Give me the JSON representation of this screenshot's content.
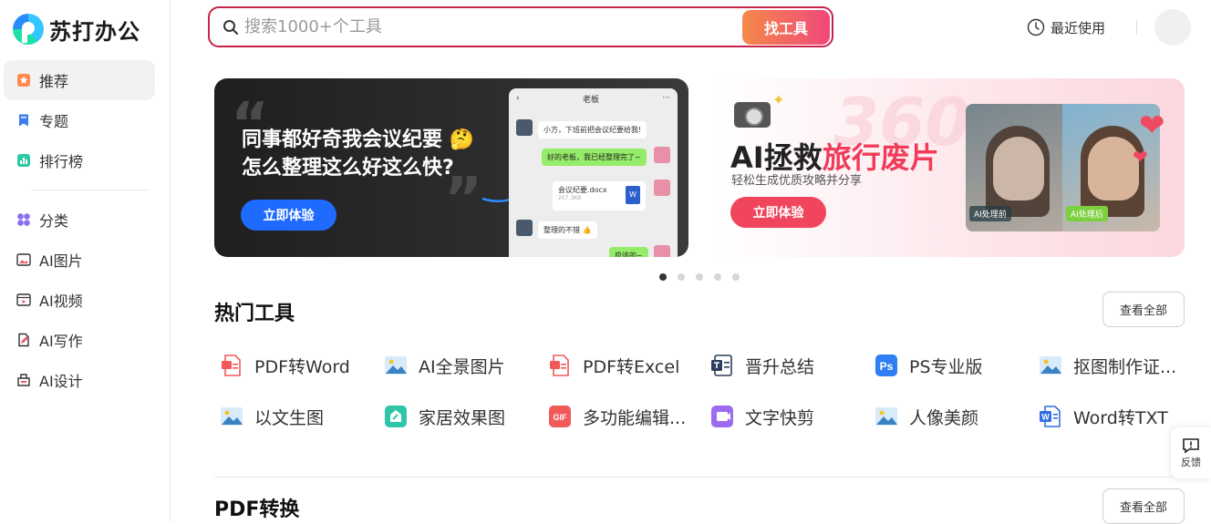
{
  "brand": {
    "name": "苏打办公"
  },
  "sidebar": {
    "items": [
      {
        "label": "推荐",
        "icon": "star-icon",
        "active": true
      },
      {
        "label": "专题",
        "icon": "bookmark-icon"
      },
      {
        "label": "排行榜",
        "icon": "chart-icon"
      }
    ],
    "items2": [
      {
        "label": "分类",
        "icon": "category-icon"
      },
      {
        "label": "AI图片",
        "icon": "image-icon"
      },
      {
        "label": "AI视频",
        "icon": "video-icon"
      },
      {
        "label": "AI写作",
        "icon": "writing-icon"
      },
      {
        "label": "AI设计",
        "icon": "design-icon"
      }
    ]
  },
  "header": {
    "search_placeholder": "搜索1000+个工具",
    "search_button": "找工具",
    "recent": "最近使用"
  },
  "banners": {
    "b1": {
      "title_line1": "同事都好奇我会议纪要 🤔",
      "title_line2": "怎么整理这么好这么快?",
      "button": "立即体验",
      "chat": {
        "name": "老板",
        "m1": "小方，下班前把会议纪要给我!",
        "m2": "好的老板，我已经整理完了~",
        "file_name": "会议纪要.docx",
        "file_size": "207.3KB",
        "m3": "整理的不错 👍",
        "m4": "应该的~"
      }
    },
    "b2": {
      "bg_number": "360",
      "title_a": "AI拯救",
      "title_b": "旅行废片",
      "subtitle": "轻松生成优质攻略并分享",
      "button": "立即体验",
      "tag_before": "AI处理前",
      "tag_after": "AI处理后"
    }
  },
  "carousel": {
    "total": 5,
    "active": 1
  },
  "hot_tools": {
    "title": "热门工具",
    "see_all": "查看全部",
    "items": [
      {
        "label": "PDF转Word",
        "icon": "pdf-icon",
        "color": "#f25a5a"
      },
      {
        "label": "AI全景图片",
        "icon": "landscape-image-icon",
        "color": "#3b82c4"
      },
      {
        "label": "PDF转Excel",
        "icon": "pdf-icon",
        "color": "#f25a5a"
      },
      {
        "label": "晋升总结",
        "icon": "document-icon",
        "color": "#2c3e5c"
      },
      {
        "label": "PS专业版",
        "icon": "ps-icon",
        "color": "#2f7ff2"
      },
      {
        "label": "抠图制作证...",
        "icon": "landscape-image-icon",
        "color": "#3b82c4"
      },
      {
        "label": "以文生图",
        "icon": "landscape-image-icon",
        "color": "#3b82c4"
      },
      {
        "label": "家居效果图",
        "icon": "home-design-icon",
        "color": "#2fc6a8"
      },
      {
        "label": "多功能编辑...",
        "icon": "gif-icon",
        "color": "#f25a5a"
      },
      {
        "label": "文字快剪",
        "icon": "video-clip-icon",
        "color": "#9b6cf0"
      },
      {
        "label": "人像美颜",
        "icon": "landscape-image-icon",
        "color": "#3b82c4"
      },
      {
        "label": "Word转TXT",
        "icon": "word-icon",
        "color": "#2f6fdf"
      }
    ]
  },
  "pdf_section": {
    "title": "PDF转换",
    "see_all": "查看全部"
  },
  "feedback": {
    "label": "反馈"
  }
}
